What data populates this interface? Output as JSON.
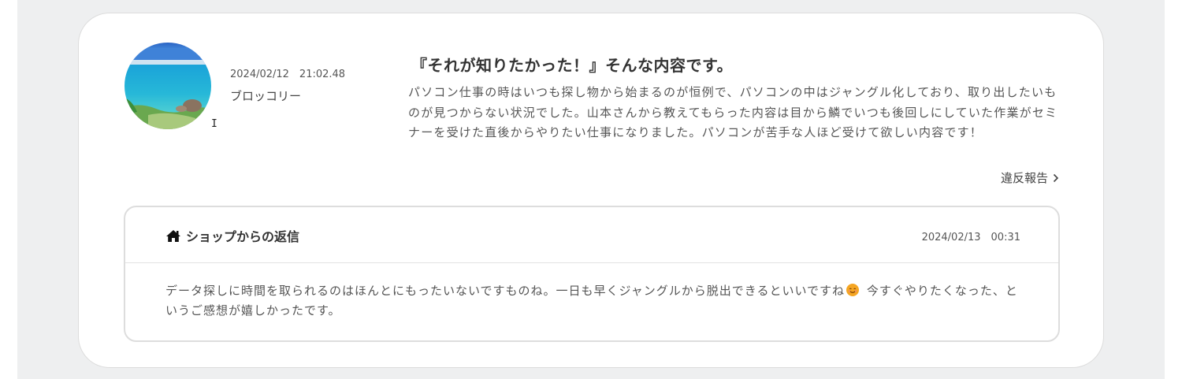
{
  "review": {
    "date": "2024/02/12　21:02.48",
    "author": "ブロッコリー",
    "title": "『それが知りたかった！』そんな内容です。",
    "body": "パソコン仕事の時はいつも探し物から始まるのが恒例で、パソコンの中はジャングル化しており、取り出したいものが見つからない状況でした。山本さんから教えてもらった内容は目から鱗でいつも後回しにしていた作業がセミナーを受けた直後からやりたい仕事になりました。パソコンが苦手な人ほど受けて欲しい内容です！",
    "report_label": "違反報告"
  },
  "reply": {
    "title": "ショップからの返信",
    "date": "2024/02/13　00:31",
    "body_before_emoji": "データ探しに時間を取られるのはほんとにもったいないですものね。一日も早くジャングルから脱出できるといいですね",
    "body_after_emoji": " 今すぐやりたくなった、というご感想が嬉しかったです。"
  },
  "icons": {
    "home": "home-icon",
    "chevron": "chevron-right-icon",
    "emoji": "smiling-face-emoji"
  },
  "colors": {
    "card_border": "#dcdcdc",
    "background": "#eeeff0",
    "emoji": "#f5a623"
  }
}
